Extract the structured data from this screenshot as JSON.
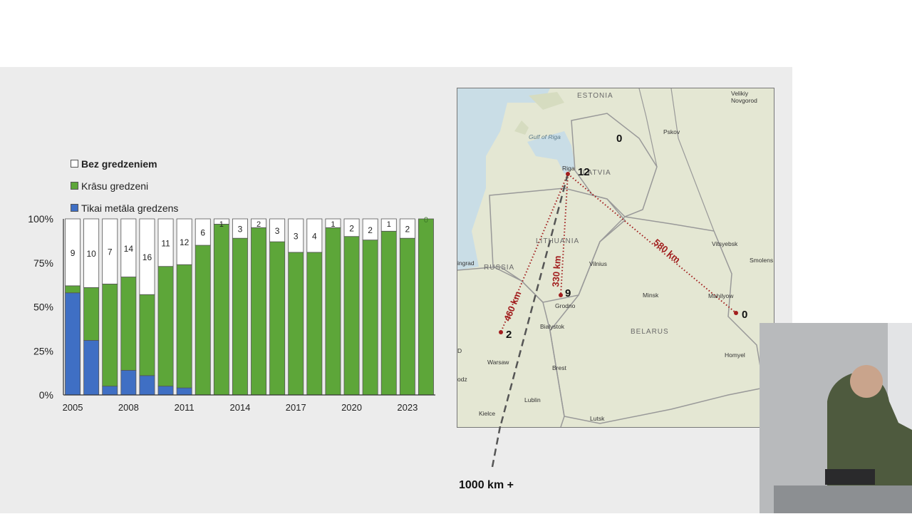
{
  "legend": [
    {
      "label": "Bez gredzeniem",
      "color": "#ffffff"
    },
    {
      "label": "Krāsu gredzeni",
      "color": "#5da639"
    },
    {
      "label": "Tikai metāla gredzens",
      "color": "#3f6fc4"
    }
  ],
  "chart_data": {
    "type": "bar",
    "stacked": true,
    "percent": true,
    "x": [
      2005,
      2006,
      2007,
      2008,
      2009,
      2010,
      2011,
      2012,
      2013,
      2014,
      2015,
      2016,
      2017,
      2018,
      2019,
      2020,
      2021,
      2022,
      2023,
      2024
    ],
    "x_tick_labels": [
      "2005",
      "2008",
      "2011",
      "2014",
      "2017",
      "2020",
      "2023"
    ],
    "y_tick_labels": [
      "0%",
      "25%",
      "50%",
      "75%",
      "100%"
    ],
    "ylim": [
      0,
      100
    ],
    "series": [
      {
        "name": "Tikai metāla gredzens",
        "color": "#3f6fc4",
        "values": [
          58,
          31,
          5,
          14,
          11,
          5,
          4,
          0,
          0,
          0,
          0,
          0,
          0,
          0,
          0,
          0,
          0,
          0,
          0,
          0
        ]
      },
      {
        "name": "Krāsu gredzeni",
        "color": "#5da639",
        "values": [
          4,
          30,
          58,
          53,
          46,
          68,
          70,
          85,
          97,
          89,
          95,
          87,
          81,
          81,
          95,
          90,
          88,
          93,
          89,
          100
        ]
      },
      {
        "name": "Bez gredzeniem",
        "color": "#ffffff",
        "values": [
          38,
          39,
          37,
          33,
          43,
          27,
          26,
          15,
          3,
          11,
          5,
          13,
          19,
          19,
          5,
          10,
          12,
          7,
          11,
          0
        ]
      }
    ],
    "data_labels": [
      "9",
      "10",
      "7",
      "14",
      "16",
      "11",
      "12",
      "6",
      "1",
      "3",
      "2",
      "3",
      "3",
      "4",
      "1",
      "2",
      "2",
      "1",
      "2",
      "0"
    ]
  },
  "map": {
    "countries": [
      "ESTONIA",
      "LATVIA",
      "LITHUANIA",
      "RUSSIA",
      "BELARUS"
    ],
    "cities": [
      "Velikiy Novgorod",
      "Pskov",
      "Gulf of Riga",
      "Riga",
      "Vitsyebsk",
      "Smolens",
      "Vilnius",
      "Minsk",
      "Mahilyow",
      "Grodno",
      "Bialystok",
      "Homyel",
      "Warsaw",
      "Brest",
      "Lublin",
      "Lutsk",
      "Kielce",
      "ingrad",
      "odz",
      "D"
    ],
    "counts": {
      "estonia": "0",
      "riga": "12",
      "grodno": "9",
      "poland": "2",
      "mahilyow": "0"
    },
    "distances": [
      "460 km",
      "330 km",
      "580 km"
    ],
    "far_label": "1000 km +"
  }
}
